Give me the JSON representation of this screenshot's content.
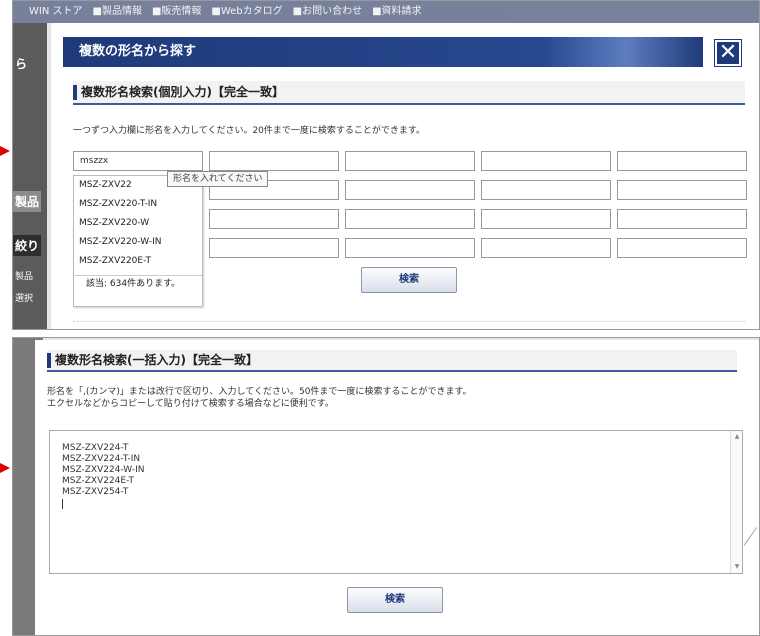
{
  "top_panel": {
    "background_nav": "WIN ストア　■製品情報　■販売情報　■Webカタログ　■お問い合わせ　■資料請求",
    "background_left": {
      "item1": "ら",
      "item2": "製品",
      "item3": "絞り",
      "item4": "製品",
      "item5": "選択"
    },
    "modal": {
      "title": "複数の形名から探す",
      "close_icon": "close-icon",
      "section_title": "複数形名検索(個別入力)【完全一致】",
      "intro": "一つずつ入力欄に形名を入力してください。20件まで一度に検索することができます。",
      "first_input_value": "mszzx",
      "tooltip": "形名を入れてください",
      "suggestions": [
        "MSZ-ZXV22",
        "MSZ-ZXV220-T-IN",
        "MSZ-ZXV220-W",
        "MSZ-ZXV220-W-IN",
        "MSZ-ZXV220E-T"
      ],
      "suggestion_count": "該当: 634件あります。",
      "search_button": "検索"
    }
  },
  "bottom_panel": {
    "section_title": "複数形名検索(一括入力)【完全一致】",
    "intro_line1": "形名を「,(カンマ)」または改行で区切り、入力してください。50件まで一度に検索することができます。",
    "intro_line2": "エクセルなどからコピーして貼り付けて検索する場合などに便利です。",
    "textarea_lines": [
      "MSZ-ZXV224-T",
      "MSZ-ZXV224-T-IN",
      "MSZ-ZXV224-W-IN",
      "MSZ-ZXV224E-T",
      "MSZ-ZXV254-T"
    ],
    "search_button": "検索"
  },
  "colors": {
    "header_blue": "#1f3a7a",
    "arrow_red": "#e00000"
  }
}
